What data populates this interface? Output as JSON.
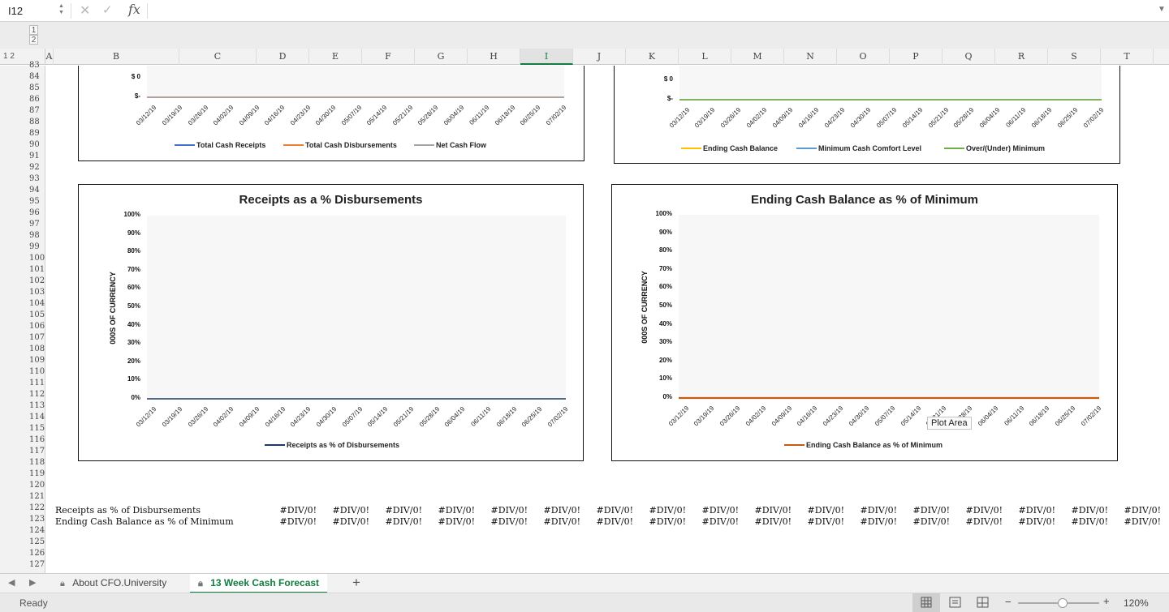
{
  "formula_bar": {
    "name_box": "I12",
    "fx_label": "fx",
    "formula_value": ""
  },
  "outline": {
    "levels": [
      "1",
      "2"
    ]
  },
  "columns": [
    "A",
    "B",
    "C",
    "D",
    "E",
    "F",
    "G",
    "H",
    "I",
    "J",
    "K",
    "L",
    "M",
    "N",
    "O",
    "P",
    "Q",
    "R",
    "S",
    "T"
  ],
  "selected_column": "I",
  "rows": [
    "83",
    "84",
    "85",
    "86",
    "87",
    "88",
    "89",
    "90",
    "91",
    "92",
    "93",
    "94",
    "95",
    "96",
    "97",
    "98",
    "99",
    "100",
    "101",
    "102",
    "103",
    "104",
    "105",
    "106",
    "107",
    "108",
    "109",
    "110",
    "111",
    "112",
    "113",
    "114",
    "115",
    "116",
    "117",
    "118",
    "119",
    "120",
    "121",
    "122",
    "123",
    "124",
    "125",
    "126",
    "127"
  ],
  "dates": [
    "03/12/19",
    "03/19/19",
    "03/26/19",
    "04/02/19",
    "04/09/19",
    "04/16/19",
    "04/23/19",
    "04/30/19",
    "05/07/19",
    "05/14/19",
    "05/21/19",
    "05/28/19",
    "06/04/19",
    "06/11/19",
    "06/18/19",
    "06/25/19",
    "07/02/19"
  ],
  "chart_data": [
    {
      "type": "line",
      "title": "",
      "y_ticks": [
        "$ 0",
        "$-"
      ],
      "categories": [
        "03/12/19",
        "03/19/19",
        "03/26/19",
        "04/02/19",
        "04/09/19",
        "04/16/19",
        "04/23/19",
        "04/30/19",
        "05/07/19",
        "05/14/19",
        "05/21/19",
        "05/28/19",
        "06/04/19",
        "06/11/19",
        "06/18/19",
        "06/25/19",
        "07/02/19"
      ],
      "series": [
        {
          "name": "Total Cash Receipts",
          "color": "#4472c4",
          "values": [
            0,
            0,
            0,
            0,
            0,
            0,
            0,
            0,
            0,
            0,
            0,
            0,
            0,
            0,
            0,
            0,
            0
          ]
        },
        {
          "name": "Total Cash Disbursements",
          "color": "#ed7d31",
          "values": [
            0,
            0,
            0,
            0,
            0,
            0,
            0,
            0,
            0,
            0,
            0,
            0,
            0,
            0,
            0,
            0,
            0
          ]
        },
        {
          "name": "Net Cash Flow",
          "color": "#a5a5a5",
          "values": [
            0,
            0,
            0,
            0,
            0,
            0,
            0,
            0,
            0,
            0,
            0,
            0,
            0,
            0,
            0,
            0,
            0
          ]
        }
      ]
    },
    {
      "type": "line",
      "title": "",
      "y_ticks": [
        "$ 0",
        "$-"
      ],
      "categories": [
        "03/12/19",
        "03/19/19",
        "03/26/19",
        "04/02/19",
        "04/09/19",
        "04/16/19",
        "04/23/19",
        "04/30/19",
        "05/07/19",
        "05/14/19",
        "05/21/19",
        "05/28/19",
        "06/04/19",
        "06/11/19",
        "06/18/19",
        "06/25/19",
        "07/02/19"
      ],
      "series": [
        {
          "name": "Ending Cash Balance",
          "color": "#ffc000",
          "values": [
            0,
            0,
            0,
            0,
            0,
            0,
            0,
            0,
            0,
            0,
            0,
            0,
            0,
            0,
            0,
            0,
            0
          ]
        },
        {
          "name": "Minimum Cash Comfort Level",
          "color": "#5b9bd5",
          "values": [
            0,
            0,
            0,
            0,
            0,
            0,
            0,
            0,
            0,
            0,
            0,
            0,
            0,
            0,
            0,
            0,
            0
          ]
        },
        {
          "name": "Over/(Under) Minimum",
          "color": "#70ad47",
          "values": [
            0,
            0,
            0,
            0,
            0,
            0,
            0,
            0,
            0,
            0,
            0,
            0,
            0,
            0,
            0,
            0,
            0
          ]
        }
      ]
    },
    {
      "type": "line",
      "title": "Receipts as a %  Disbursements",
      "ylabel": "000S OF CURRENCY",
      "y_ticks": [
        "100%",
        "90%",
        "80%",
        "70%",
        "60%",
        "50%",
        "40%",
        "30%",
        "20%",
        "10%",
        "0%"
      ],
      "ylim": [
        0,
        1
      ],
      "categories": [
        "03/12/19",
        "03/19/19",
        "03/26/19",
        "04/02/19",
        "04/09/19",
        "04/16/19",
        "04/23/19",
        "04/30/19",
        "05/07/19",
        "05/14/19",
        "05/21/19",
        "05/28/19",
        "06/04/19",
        "06/11/19",
        "06/18/19",
        "06/25/19",
        "07/02/19"
      ],
      "series": [
        {
          "name": "Receipts as % of Disbursements",
          "color": "#1f3864",
          "values": [
            0,
            0,
            0,
            0,
            0,
            0,
            0,
            0,
            0,
            0,
            0,
            0,
            0,
            0,
            0,
            0,
            0
          ]
        }
      ]
    },
    {
      "type": "line",
      "title": "Ending Cash Balance as % of Minimum",
      "ylabel": "000S OF CURRENCY",
      "y_ticks": [
        "100%",
        "90%",
        "80%",
        "70%",
        "60%",
        "50%",
        "40%",
        "30%",
        "20%",
        "10%",
        "0%"
      ],
      "ylim": [
        0,
        1
      ],
      "categories": [
        "03/12/19",
        "03/19/19",
        "03/26/19",
        "04/02/19",
        "04/09/19",
        "04/16/19",
        "04/23/19",
        "04/30/19",
        "05/07/19",
        "05/14/19",
        "05/21/19",
        "05/28/19",
        "06/04/19",
        "06/11/19",
        "06/18/19",
        "06/25/19",
        "07/02/19"
      ],
      "series": [
        {
          "name": "Ending Cash Balance as % of Minimum",
          "color": "#c55a11",
          "values": [
            0,
            0,
            0,
            0,
            0,
            0,
            0,
            0,
            0,
            0,
            0,
            0,
            0,
            0,
            0,
            0,
            0
          ]
        }
      ]
    }
  ],
  "tooltip": "Plot Area",
  "table_rows": [
    {
      "label": "Receipts as % of Disbursements",
      "values": [
        "#DIV/0!",
        "#DIV/0!",
        "#DIV/0!",
        "#DIV/0!",
        "#DIV/0!",
        "#DIV/0!",
        "#DIV/0!",
        "#DIV/0!",
        "#DIV/0!",
        "#DIV/0!",
        "#DIV/0!",
        "#DIV/0!",
        "#DIV/0!",
        "#DIV/0!",
        "#DIV/0!",
        "#DIV/0!",
        "#DIV/0!"
      ]
    },
    {
      "label": "Ending Cash Balance as % of Minimum",
      "values": [
        "#DIV/0!",
        "#DIV/0!",
        "#DIV/0!",
        "#DIV/0!",
        "#DIV/0!",
        "#DIV/0!",
        "#DIV/0!",
        "#DIV/0!",
        "#DIV/0!",
        "#DIV/0!",
        "#DIV/0!",
        "#DIV/0!",
        "#DIV/0!",
        "#DIV/0!",
        "#DIV/0!",
        "#DIV/0!",
        "#DIV/0!"
      ]
    }
  ],
  "tabs": [
    {
      "label": "About CFO.University",
      "active": false
    },
    {
      "label": "13 Week Cash Forecast",
      "active": true
    }
  ],
  "add_sheet": "+",
  "status": {
    "ready": "Ready",
    "zoom": "120%",
    "zoom_level": 0.55,
    "zoom_minus": "−",
    "zoom_plus": "+"
  }
}
